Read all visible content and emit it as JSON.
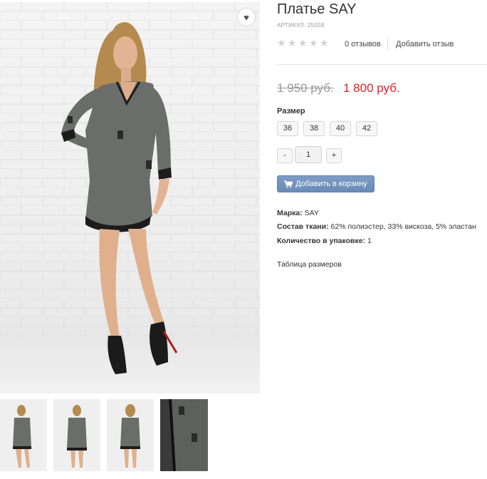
{
  "product": {
    "title": "Платье SAY",
    "sku": "АРТИКУЛ: 25058",
    "reviews_count": "0 отзывов",
    "add_review": "Добавить отзыв",
    "old_price": "1 950 руб.",
    "new_price": "1 800 руб.",
    "rating": 0,
    "rating_max": 5
  },
  "sizes": {
    "label": "Размер",
    "options": [
      "36",
      "38",
      "40",
      "42"
    ]
  },
  "quantity": {
    "minus": "-",
    "value": "1",
    "plus": "+"
  },
  "cart": {
    "label": "Добавить в корзину"
  },
  "specs": [
    {
      "key": "Марка:",
      "value": "SAY"
    },
    {
      "key": "Состав ткани:",
      "value": "62% полиэстер, 33% вискоза, 5% эластан"
    },
    {
      "key": "Количество в упаковке:",
      "value": "1"
    }
  ],
  "size_table_link": "Таблица размеров",
  "colors": {
    "price_new": "#e31e24",
    "price_old": "#999999",
    "cart_button": "#6f8fbc",
    "dress": "#6b6d6a"
  },
  "icons": [
    "heart-icon",
    "star-icon",
    "cart-icon"
  ]
}
